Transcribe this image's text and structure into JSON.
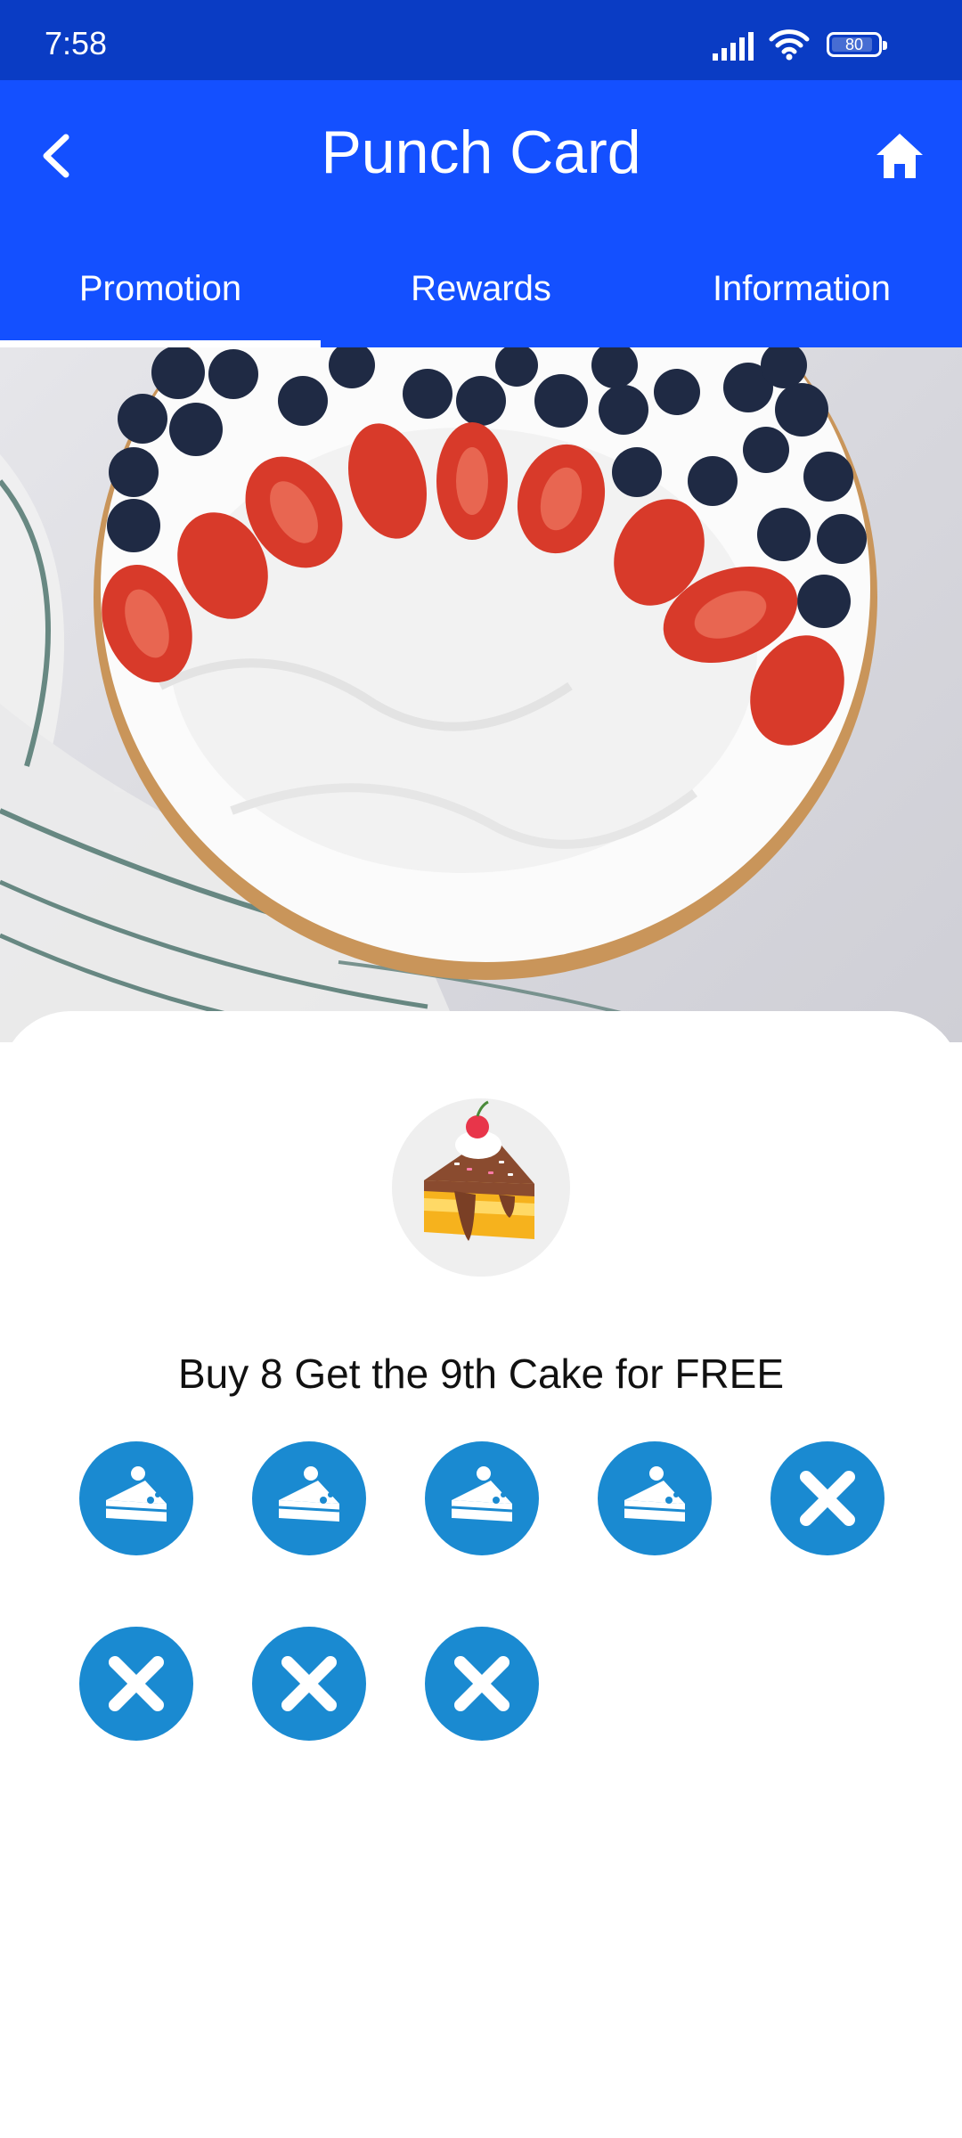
{
  "status_bar": {
    "time": "7:58",
    "battery": "80"
  },
  "header": {
    "title": "Punch Card",
    "back_icon": "chevron-left-icon",
    "home_icon": "home-icon"
  },
  "tabs": [
    {
      "label": "Promotion",
      "active": true
    },
    {
      "label": "Rewards",
      "active": false
    },
    {
      "label": "Information",
      "active": false
    }
  ],
  "promotion": {
    "title": "Buy 8 Get the 9th Cake for FREE",
    "stamps_total": 8,
    "stamps_collected": 4
  },
  "colors": {
    "status_bar": "#0a3cc4",
    "app_bar": "#1450ff",
    "stamp": "#1a8ad1"
  }
}
